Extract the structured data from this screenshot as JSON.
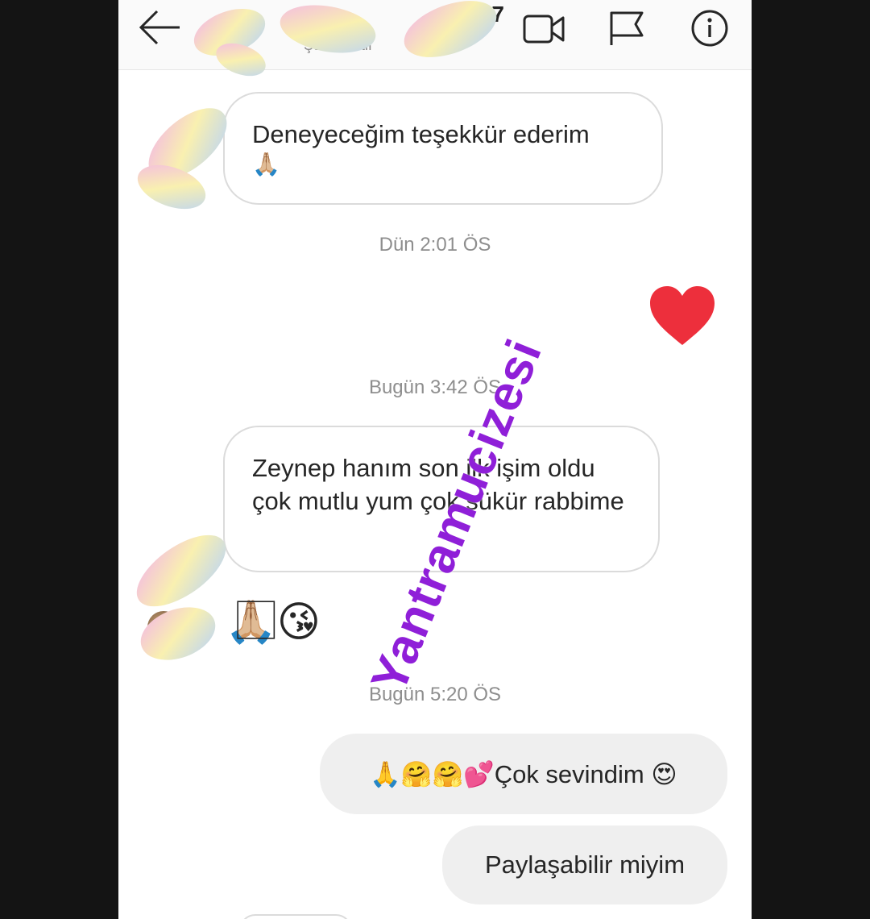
{
  "header": {
    "name": "7",
    "subtitle": "Şu an aktif",
    "icons": [
      "back-arrow-icon",
      "video-call-icon",
      "flag-icon",
      "info-icon"
    ]
  },
  "messages": {
    "m1": {
      "text": "Deneyeceğim teşekkür ederim",
      "emoji": "🙏🏼"
    },
    "stamp1": "Dün 2:01 ÖS",
    "reaction": "❤",
    "stamp2": "Bugün 3:42 ÖS",
    "m2": {
      "text": "Zeynep hanım son ilk işim oldu çok mutlu yum çok şükür rabbime"
    },
    "m3": {
      "text": "🙏🏼⃞😘"
    },
    "stamp3": "Bugün 5:20 ÖS",
    "m4": {
      "text": "🙏🤗🤗💕Çok sevindim 😍"
    },
    "m5": {
      "text": "Paylaşabilir miyim"
    }
  },
  "watermark": "Yantramucizesi",
  "colors": {
    "heart": "#ed2f3c",
    "watermark": "#8f1fd8",
    "outgoing_bubble": "#efefef",
    "stamp": "#8e8e8e"
  }
}
